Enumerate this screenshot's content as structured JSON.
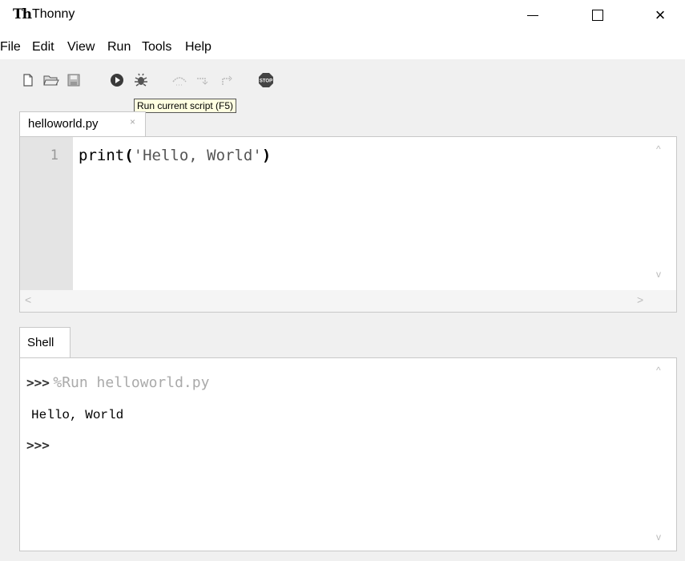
{
  "window": {
    "title": "Thonny",
    "logo_text": "Th",
    "minimize_icon": "minimize-icon",
    "maximize_icon": "maximize-icon",
    "close_glyph": "×"
  },
  "menu": {
    "items": [
      "File",
      "Edit",
      "View",
      "Run",
      "Tools",
      "Help"
    ]
  },
  "toolbar": {
    "icons": [
      "new-file-icon",
      "open-folder-icon",
      "save-icon",
      "run-icon",
      "debug-icon",
      "step-over-icon",
      "step-into-icon",
      "step-out-icon",
      "stop-icon"
    ],
    "stop_label": "STOP",
    "tooltip": "Run current script (F5)"
  },
  "editor": {
    "tab_label": "helloworld.py",
    "tab_close": "×",
    "line_numbers": [
      "1"
    ],
    "code": {
      "func": "print",
      "open": "(",
      "str": "'Hello, World'",
      "close": ")"
    },
    "scroll_up": "^",
    "scroll_down": "v",
    "scroll_left": "<",
    "scroll_right": ">"
  },
  "shell": {
    "tab_label": "Shell",
    "prompt": ">>>",
    "command": "%Run helloworld.py",
    "output": "Hello, World",
    "prompt2": ">>>",
    "scroll_up": "^",
    "scroll_down": "v"
  }
}
